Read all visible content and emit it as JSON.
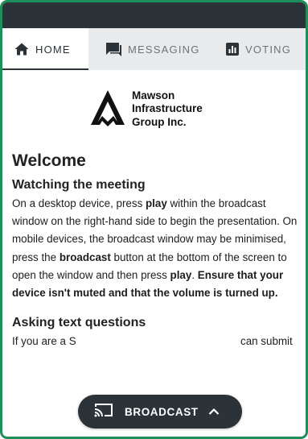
{
  "tabs": [
    {
      "label": "HOME",
      "icon": "home-icon",
      "active": true
    },
    {
      "label": "MESSAGING",
      "icon": "messaging-icon",
      "active": false
    },
    {
      "label": "VOTING",
      "icon": "voting-icon",
      "active": false
    }
  ],
  "logo": {
    "line1": "Mawson",
    "line2": "Infrastructure",
    "line3": "Group Inc."
  },
  "content": {
    "welcome": "Welcome",
    "watching": {
      "heading": "Watching the meeting",
      "p1": "On a desktop device, press ",
      "b1": "play",
      "p2": " within the broadcast window on the right-hand side to begin the presentation. On mobile devices, the broadcast window may be minimised, press the ",
      "b2": "broadcast",
      "p3": " button at the bottom of the screen to open the window and then press ",
      "b3": "play",
      "p4": ". ",
      "b4": "Ensure that your device isn't muted and that the volume is turned up."
    },
    "questions": {
      "heading": "Asking text questions",
      "p1_start": "If you are a S",
      "p1_end": "can submit"
    }
  },
  "broadcast_button": {
    "label": "BROADCAST",
    "icon": "cast-icon",
    "chevron": "chevron-up-icon"
  },
  "colors": {
    "frame_border": "#1e8f5a",
    "dark": "#2b3338",
    "tab_bar": "#e9eaeb",
    "tab_inactive_text": "#6f7376"
  }
}
